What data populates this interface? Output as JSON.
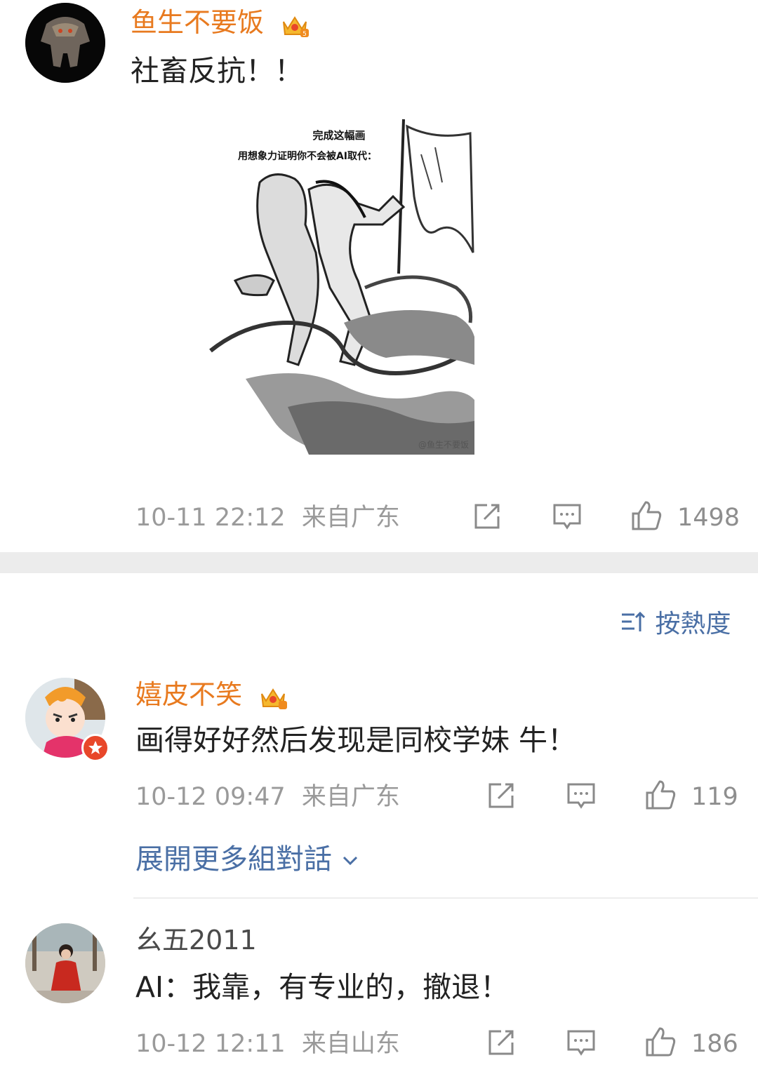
{
  "comments": [
    {
      "username": "鱼生不要饭",
      "text": "社畜反抗！！",
      "time": "10-11 22:12",
      "location": "来自广东",
      "likes": "1498",
      "has_crown": true,
      "image": {
        "title": "完成这幅画",
        "subtitle": "用想象力证明你不会被AI取代：",
        "watermark": "@鱼生不要饭"
      }
    },
    {
      "username": "嬉皮不笑",
      "text": "画得好好然后发现是同校学妹 牛！",
      "time": "10-12 09:47",
      "location": "来自广东",
      "likes": "119",
      "has_crown": true,
      "expand_label": "展開更多組對話"
    },
    {
      "username": "幺五2011",
      "text": "AI：我靠，有专业的，撤退！",
      "time": "10-12 12:11",
      "location": "来自山东",
      "likes": "186",
      "has_crown": false
    }
  ],
  "sort": {
    "label": "按熱度",
    "icon": "sort-icon"
  },
  "colors": {
    "username_vip": "#e87a1f",
    "link": "#4a6fa5",
    "meta": "#9a9a9a",
    "divider": "#ececec"
  },
  "icons": [
    "crown-icon",
    "share-icon",
    "comment-icon",
    "like-icon",
    "chevron-down-icon"
  ]
}
